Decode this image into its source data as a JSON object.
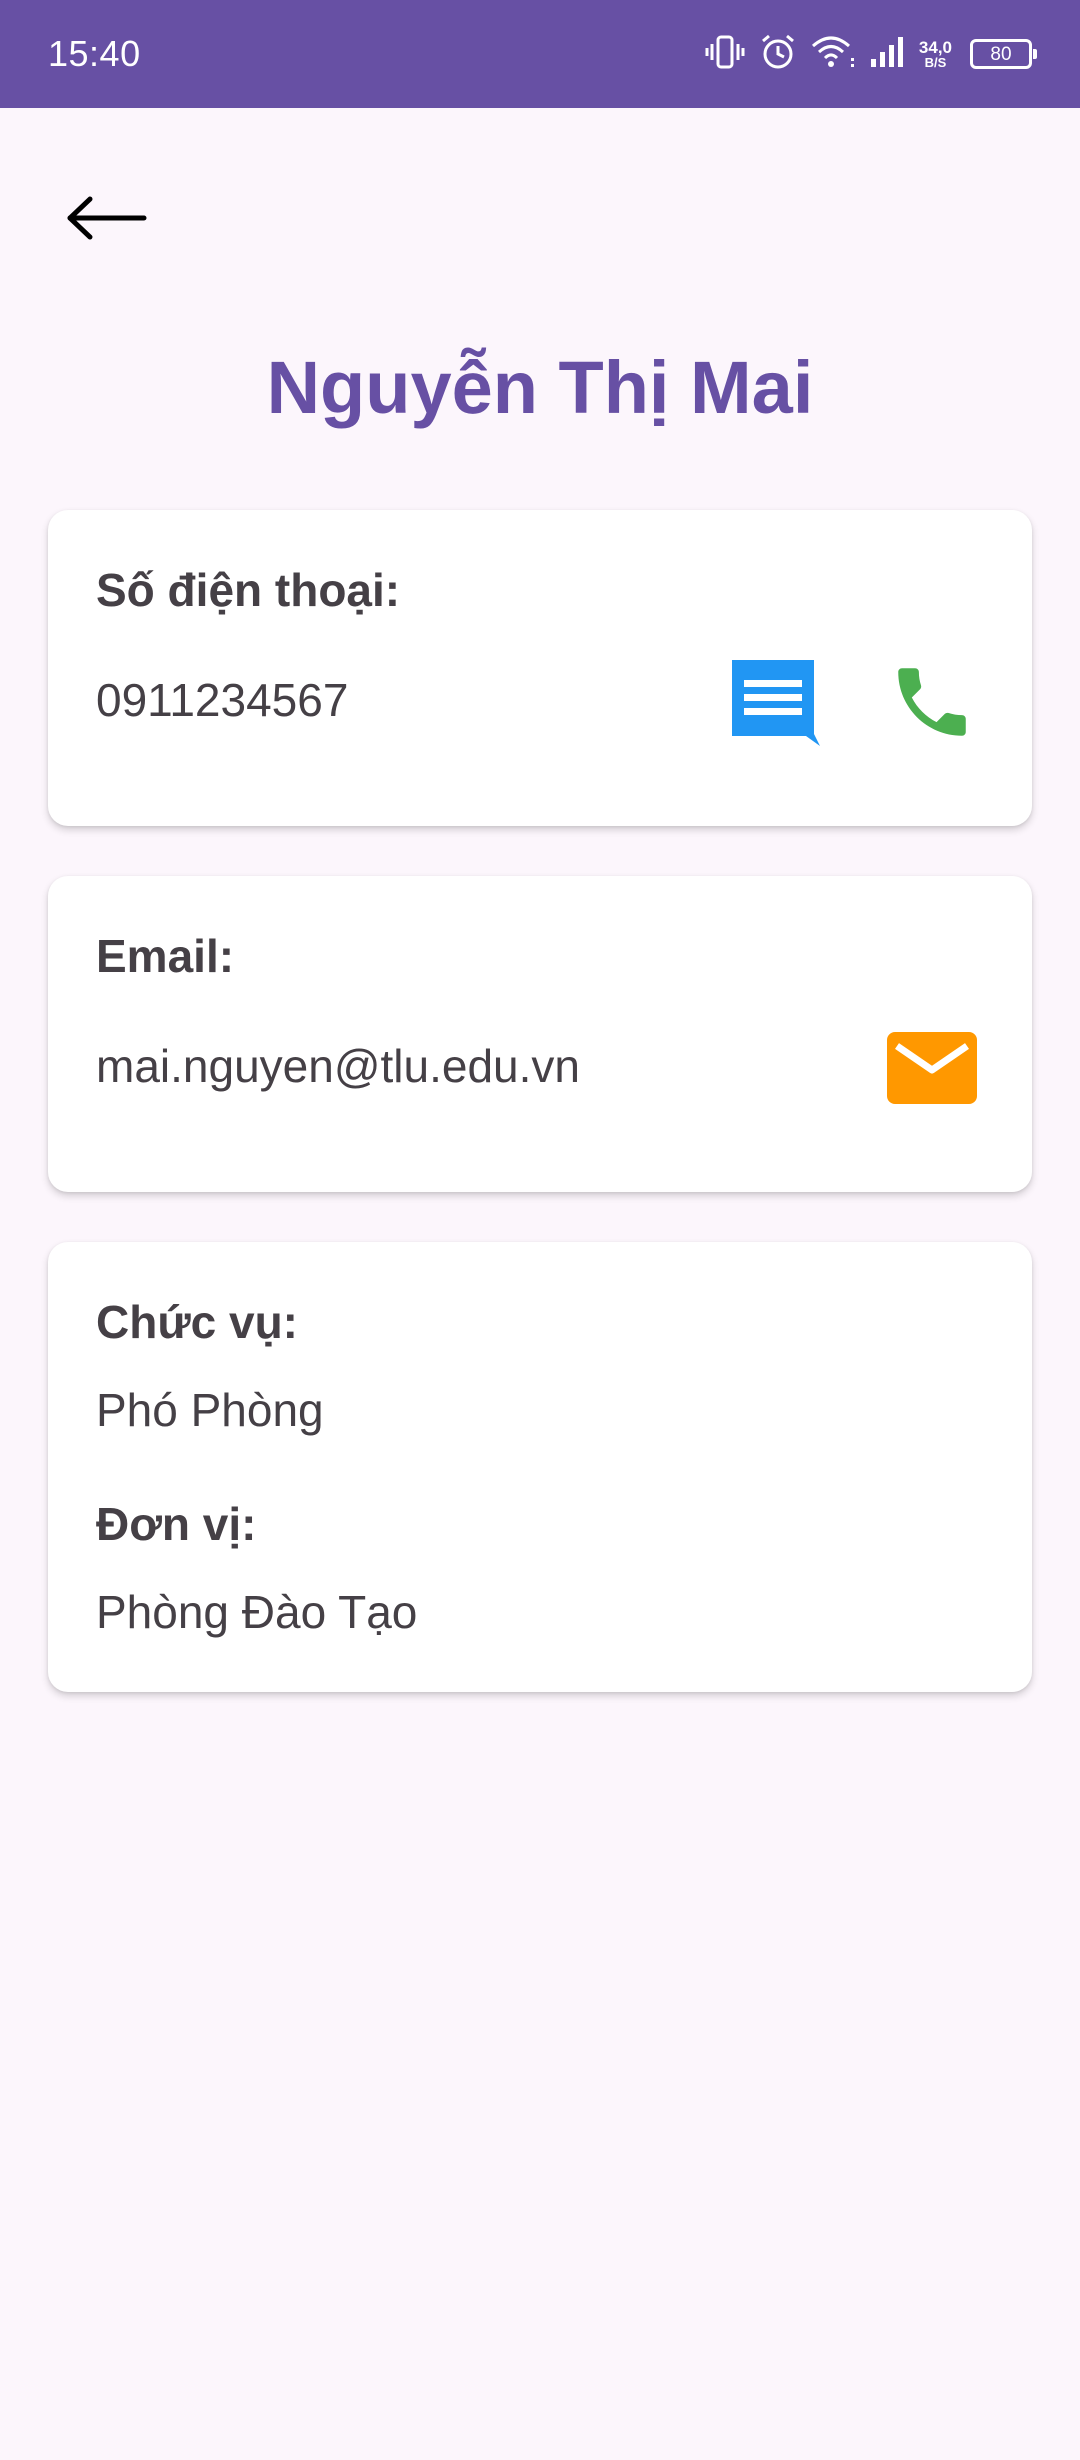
{
  "status_bar": {
    "time": "15:40",
    "net_speed_value": "34,0",
    "net_speed_unit": "B/S",
    "battery": "80"
  },
  "contact": {
    "name": "Nguyễn Thị Mai"
  },
  "phone_card": {
    "label": "Số điện thoại:",
    "value": "0911234567"
  },
  "email_card": {
    "label": "Email:",
    "value": "mai.nguyen@tlu.edu.vn"
  },
  "info_card": {
    "position_label": "Chức vụ:",
    "position_value": "Phó Phòng",
    "unit_label": "Đơn vị:",
    "unit_value": "Phòng Đào Tạo"
  },
  "icons": {
    "back": "arrow-left-icon",
    "message": "message-icon",
    "phone": "phone-icon",
    "email": "mail-icon"
  },
  "colors": {
    "primary": "#6750A4",
    "background": "#FCF6FC",
    "message_icon": "#2196F3",
    "phone_icon": "#4CAF50",
    "email_icon": "#FF9800",
    "text": "#454046"
  }
}
